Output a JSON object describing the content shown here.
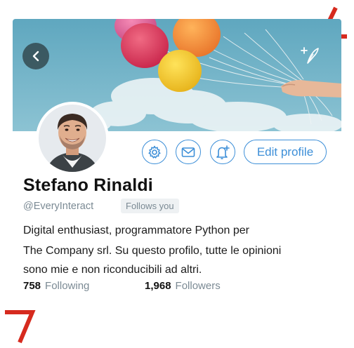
{
  "profile": {
    "name": "Stefano Rinaldi",
    "handle": "@EveryInteract",
    "follows_badge": "Follows you",
    "bio_lines": [
      "Digital enthusiast, programmatore Python per",
      "The Company srl. Su questo profilo, tutte le opinioni",
      "sono mie e non riconducibili ad altri."
    ]
  },
  "actions": {
    "edit_profile_label": "Edit profile",
    "icons": [
      "gear-icon",
      "envelope-icon",
      "bell-plus-icon"
    ]
  },
  "stats": {
    "following_count": "758",
    "following_label": "Following",
    "followers_count": "1,968",
    "followers_label": "Followers"
  },
  "colors": {
    "accent": "#3d8fd8",
    "muted_text": "#7b8a94",
    "corner_marks": "#d62a1e"
  }
}
